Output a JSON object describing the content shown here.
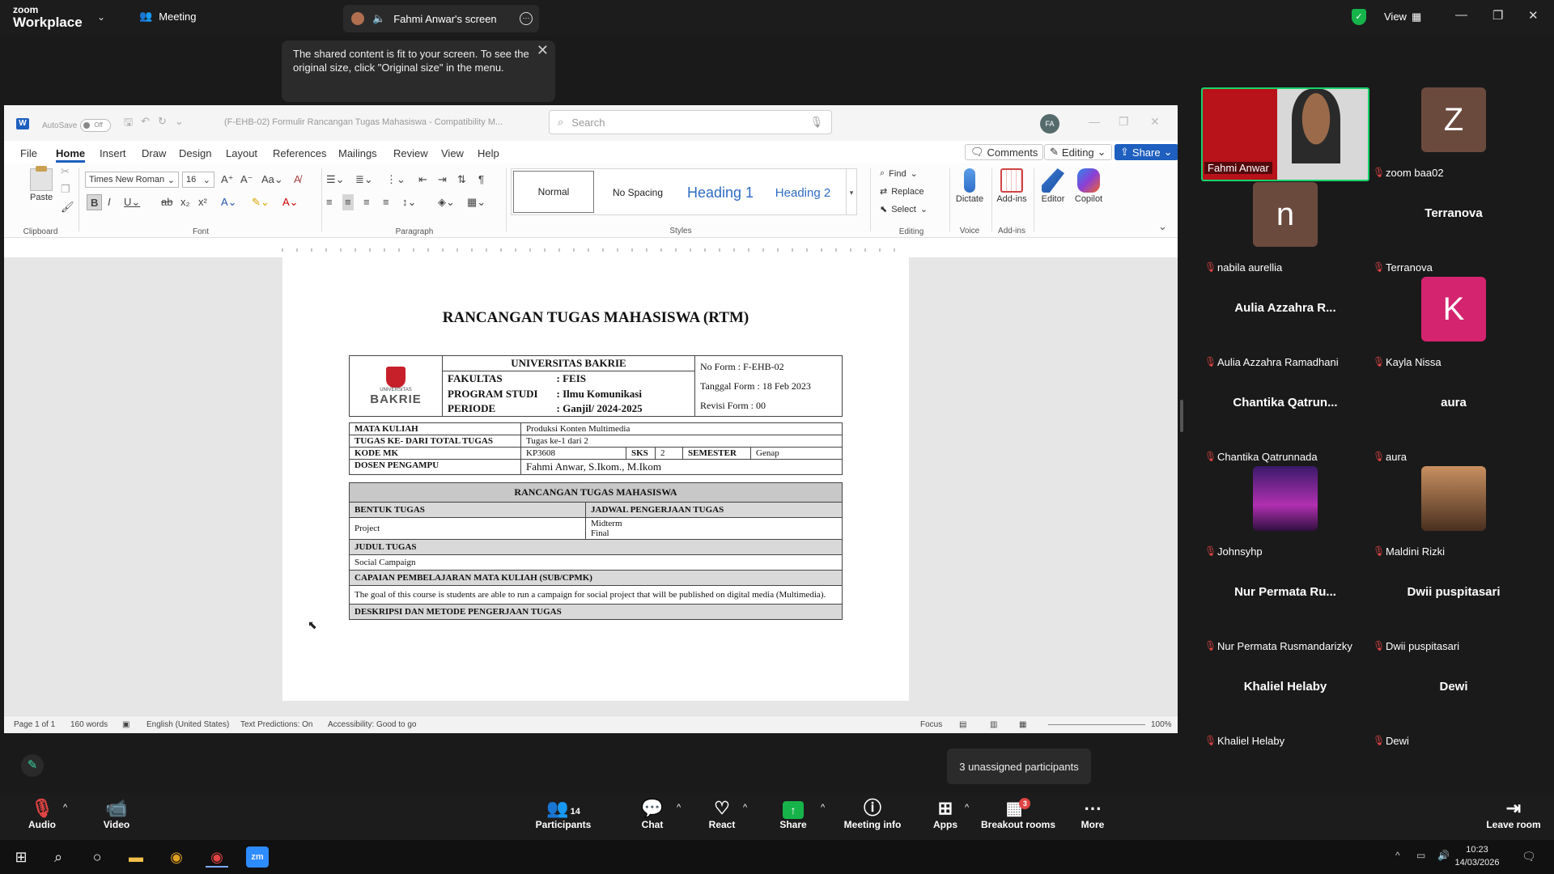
{
  "zoom": {
    "logo_small": "zoom",
    "logo_big": "Workplace",
    "meeting_label": "Meeting",
    "share_tab": "Fahmi Anwar's screen",
    "view_label": "View",
    "toast": "The shared content is fit to your screen. To see the original size, click \"Original size\" in the menu."
  },
  "word": {
    "autosave": "AutoSave",
    "toggle": "Off",
    "doc_title": "(F-EHB-02) Formulir Rancangan Tugas Mahasiswa  -  Compatibility M...",
    "search_placeholder": "Search",
    "user_initials": "FA",
    "menu": [
      "File",
      "Home",
      "Insert",
      "Draw",
      "Design",
      "Layout",
      "References",
      "Mailings",
      "Review",
      "View",
      "Help"
    ],
    "comments": "Comments",
    "editing": "Editing",
    "share": "Share",
    "paste": "Paste",
    "font_name": "Times New Roman",
    "font_size": "16",
    "groups": {
      "clipboard": "Clipboard",
      "font": "Font",
      "paragraph": "Paragraph",
      "styles": "Styles",
      "editing": "Editing",
      "voice": "Voice",
      "addins": "Add-ins"
    },
    "styles": [
      "Normal",
      "No Spacing",
      "Heading 1",
      "Heading 2"
    ],
    "find": "Find",
    "replace": "Replace",
    "select": "Select",
    "dictate": "Dictate",
    "addins_btn": "Add-ins",
    "editor": "Editor",
    "copilot": "Copilot",
    "status": {
      "page": "Page 1 of 1",
      "words": "160 words",
      "lang": "English (United States)",
      "pred": "Text Predictions: On",
      "access": "Accessibility: Good to go",
      "focus": "Focus",
      "zoom": "100%"
    }
  },
  "doc": {
    "title": "RANCANGAN TUGAS MAHASISWA (RTM)",
    "univ": "UNIVERSITAS BAKRIE",
    "logo_text": "BAKRIE",
    "logo_small": "UNIVERSITAS",
    "fakultas_l": "FAKULTAS",
    "fakultas_v": ": FEIS",
    "prodi_l": "PROGRAM STUDI",
    "prodi_v": ": Ilmu Komunikasi",
    "periode_l": "PERIODE",
    "periode_v": ": Ganjil/ 2024-2025",
    "noform": "No Form       : F-EHB-02",
    "tgl": "Tanggal Form : 18 Feb 2023",
    "rev": "Revisi Form    : 00",
    "mk_l": "MATA KULIAH",
    "mk_v": "Produksi Konten Multimedia",
    "tugas_l": "TUGAS KE- DARI TOTAL TUGAS",
    "tugas_v": "Tugas ke-1 dari 2",
    "kode_l": "KODE MK",
    "kode_v": "KP3608",
    "sks_l": "SKS",
    "sks_v": "2",
    "sem_l": "SEMESTER",
    "sem_v": "Genap",
    "dosen_l": "DOSEN PENGAMPU",
    "dosen_v": "Fahmi Anwar, S.Ikom., M.Ikom",
    "rtm_h": "RANCANGAN TUGAS MAHASISWA",
    "bentuk_h": "BENTUK TUGAS",
    "jadwal_h": "JADWAL PENGERJAAN TUGAS",
    "bentuk_v": "Project",
    "jadwal_v1": "Midterm",
    "jadwal_v2": "Final",
    "judul_h": "JUDUL TUGAS",
    "judul_v": "Social Campaign",
    "cap_h": "CAPAIAN PEMBELAJARAN MATA KULIAH (SUB/CPMK)",
    "cap_v": "The goal of this course is students are able to run a campaign for social project that will be published on digital media (Multimedia).",
    "next_h": "DESKRIPSI DAN METODE PENGERJAAN TUGAS"
  },
  "participants": [
    {
      "display": "",
      "label": "Fahmi Anwar",
      "type": "video"
    },
    {
      "display": "Z",
      "label": "zoom baa02",
      "type": "avatar",
      "color": "#6b4a3e"
    },
    {
      "display": "n",
      "label": "nabila aurellia",
      "type": "avatar",
      "color": "#6b4a3e"
    },
    {
      "display": "Terranova",
      "label": "Terranova",
      "type": "name"
    },
    {
      "display": "Aulia Azzahra R...",
      "label": "Aulia Azzahra Ramadhani",
      "type": "name"
    },
    {
      "display": "K",
      "label": "Kayla Nissa",
      "type": "avatar",
      "color": "#d4246f"
    },
    {
      "display": "Chantika  Qatrun...",
      "label": "Chantika Qatrunnada",
      "type": "name"
    },
    {
      "display": "aura",
      "label": "aura",
      "type": "name"
    },
    {
      "display": "",
      "label": "Johnsyhp",
      "type": "pic"
    },
    {
      "display": "",
      "label": "Maldini Rizki",
      "type": "pic2"
    },
    {
      "display": "Nur Permata Ru...",
      "label": "Nur Permata Rusmandarizky",
      "type": "name"
    },
    {
      "display": "Dwii puspitasari",
      "label": "Dwii puspitasari",
      "type": "name"
    },
    {
      "display": "Khaliel Helaby",
      "label": "Khaliel Helaby",
      "type": "name"
    },
    {
      "display": "Dewi",
      "label": "Dewi",
      "type": "name"
    }
  ],
  "controls": {
    "audio": "Audio",
    "video": "Video",
    "participants": "Participants",
    "participants_count": "14",
    "chat": "Chat",
    "react": "React",
    "share": "Share",
    "info": "Meeting info",
    "apps": "Apps",
    "breakout": "Breakout rooms",
    "breakout_badge": "3",
    "more": "More",
    "leave": "Leave room"
  },
  "unassigned": "3 unassigned participants",
  "taskbar": {
    "time": "10:23",
    "date": "14/03/2026"
  }
}
